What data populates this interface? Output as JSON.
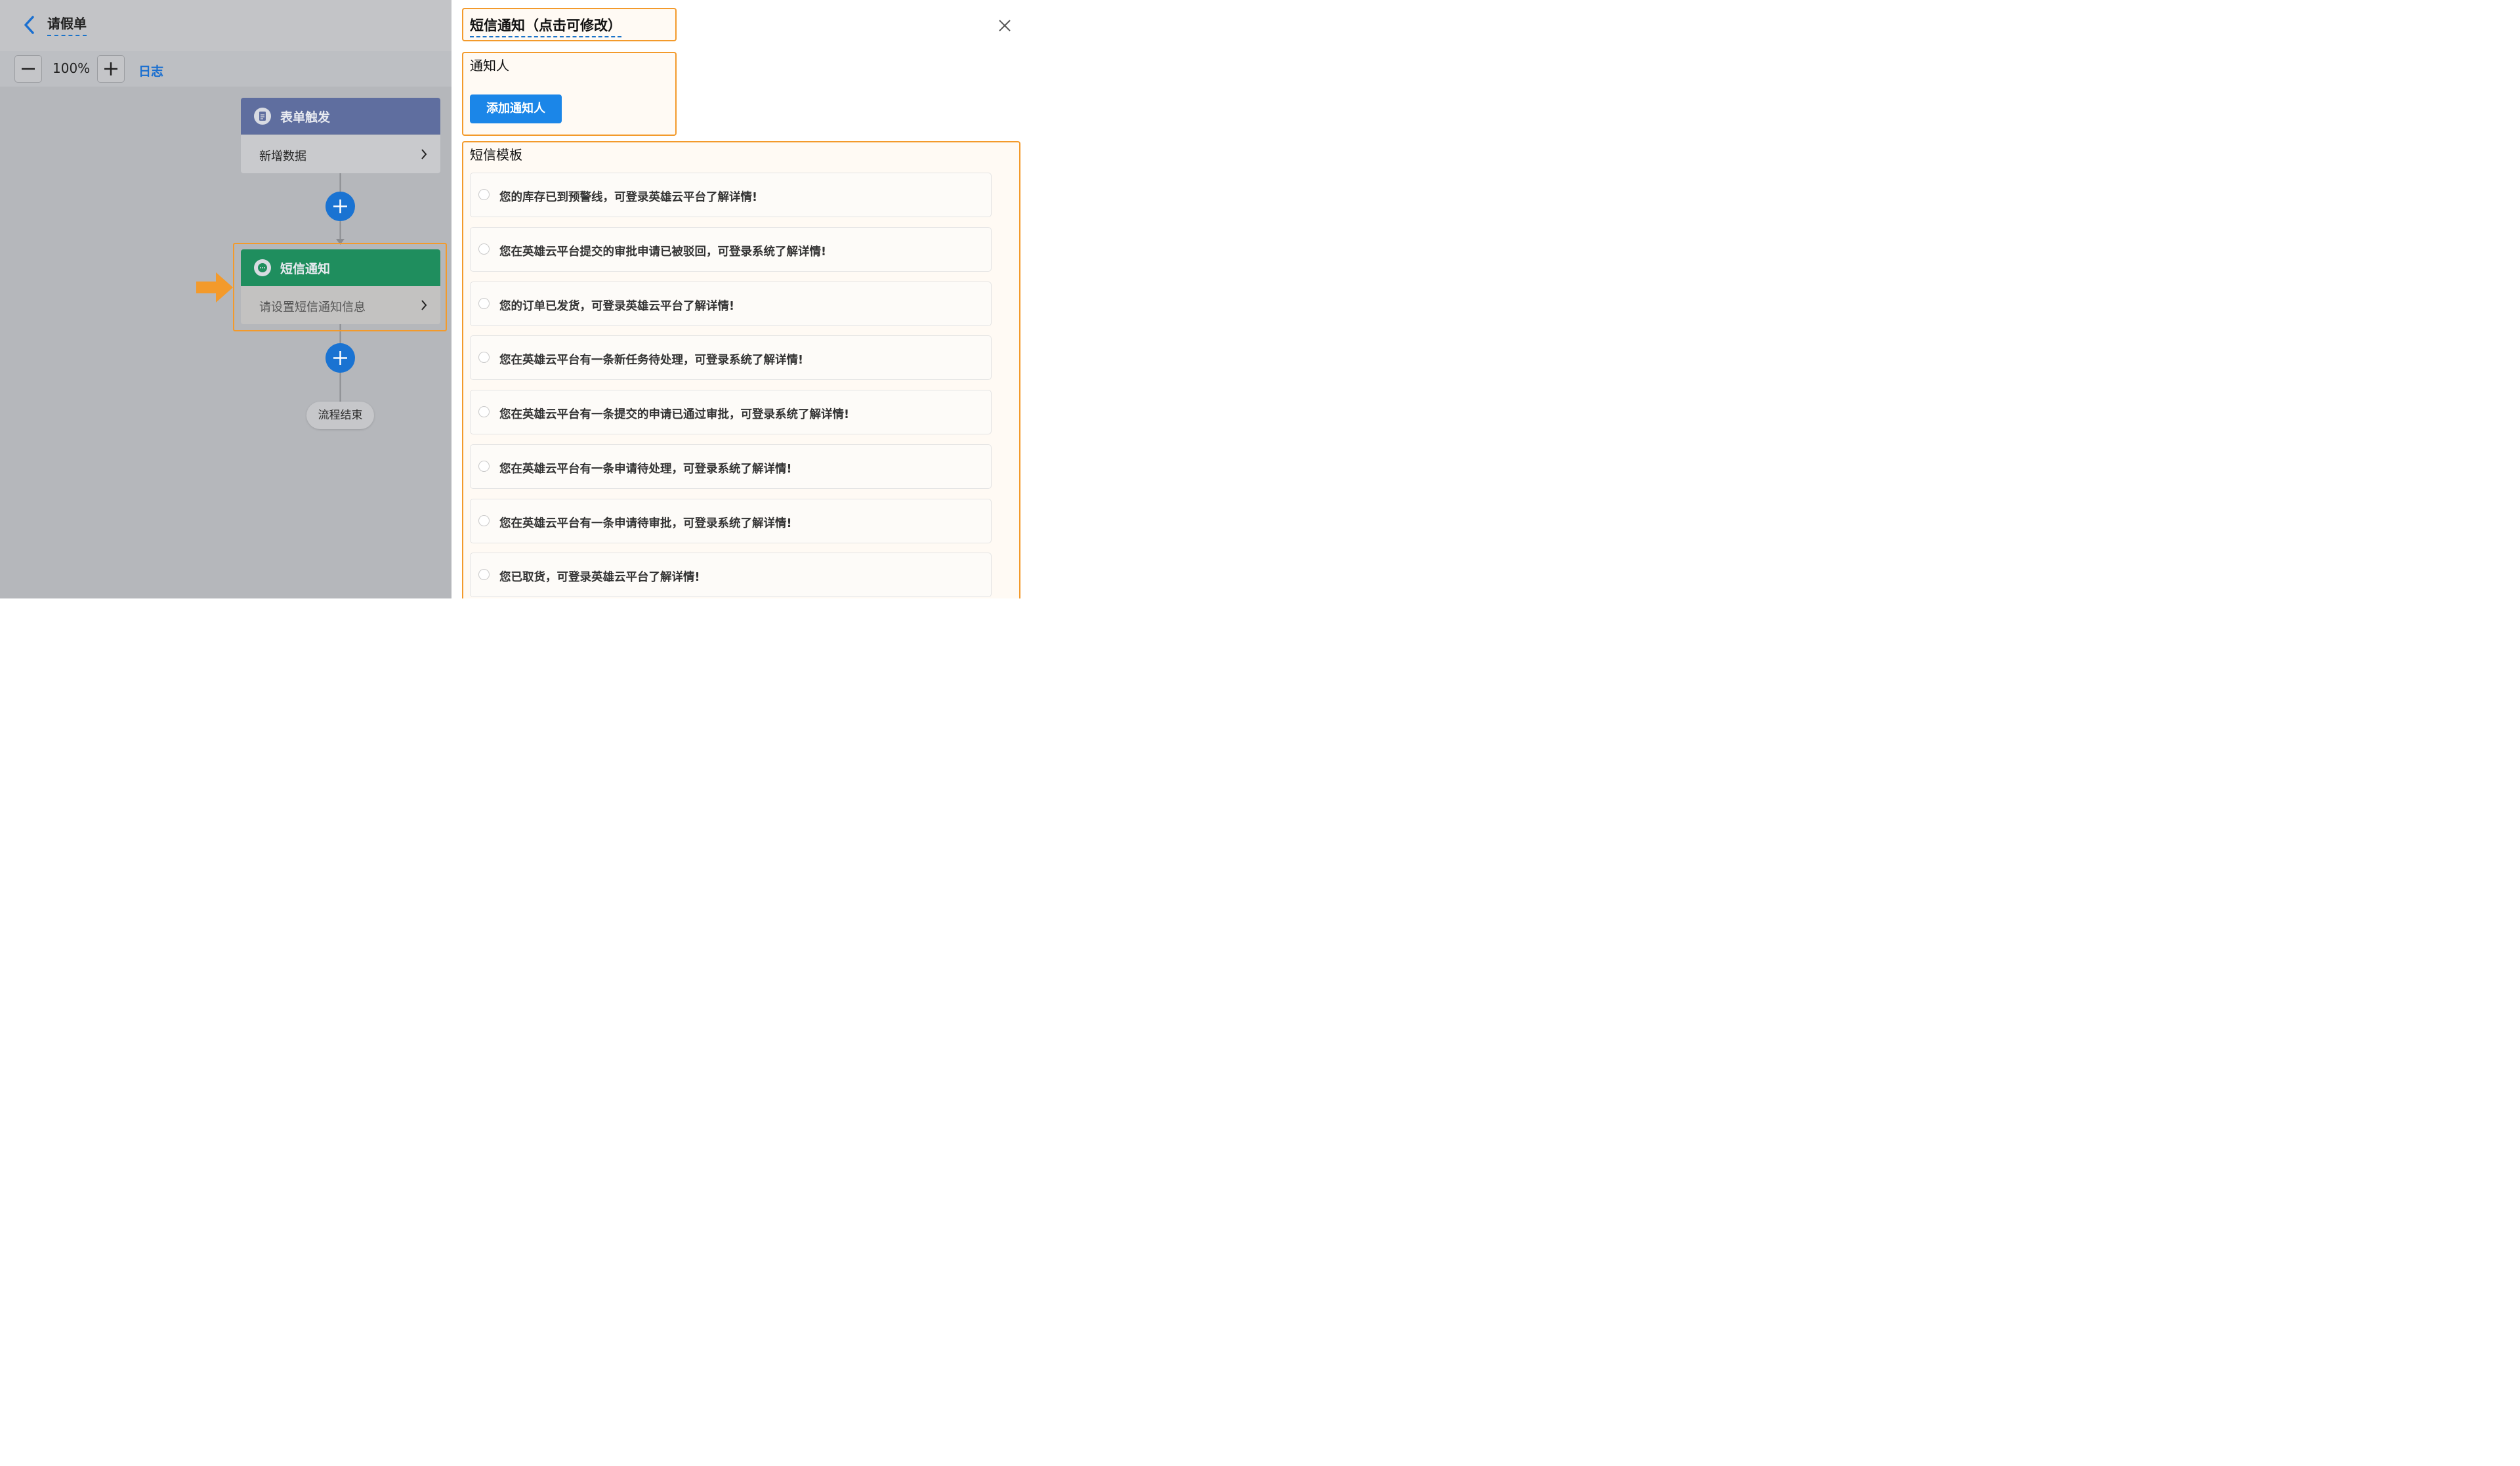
{
  "header": {
    "title": "请假单"
  },
  "zoom": {
    "value": "100%",
    "log_label": "日志"
  },
  "flow": {
    "trigger": {
      "title": "表单触发",
      "body": "新增数据"
    },
    "sms_node": {
      "title": "短信通知",
      "body": "请设置短信通知信息"
    },
    "end": "流程结束"
  },
  "panel": {
    "title": "短信通知（点击可修改）",
    "notify_label": "通知人",
    "add_recipient": "添加通知人",
    "template_label": "短信模板",
    "templates": [
      "您的库存已到预警线，可登录英雄云平台了解详情!",
      "您在英雄云平台提交的审批申请已被驳回，可登录系统了解详情!",
      "您的订单已发货，可登录英雄云平台了解详情!",
      "您在英雄云平台有一条新任务待处理，可登录系统了解详情!",
      "您在英雄云平台有一条提交的申请已通过审批，可登录系统了解详情!",
      "您在英雄云平台有一条申请待处理，可登录系统了解详情!",
      "您在英雄云平台有一条申请待审批，可登录系统了解详情!",
      "您已取货，可登录英雄云平台了解详情!"
    ]
  },
  "colors": {
    "accent_blue": "#1a73d2",
    "highlight_orange": "#f39a2b",
    "trigger_header": "#5f6e9f",
    "sms_header": "#1f8e5e"
  }
}
